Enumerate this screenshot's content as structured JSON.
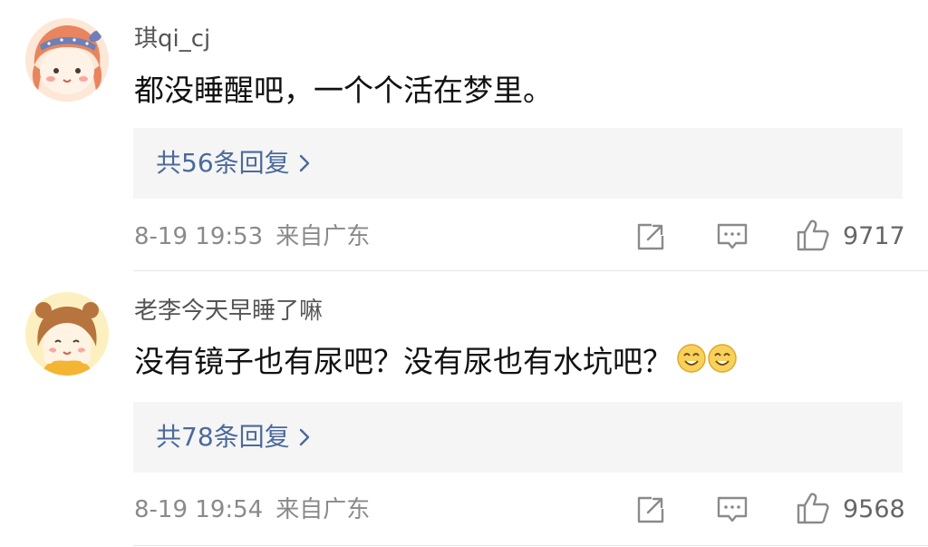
{
  "comments": [
    {
      "username": "琪qi_cj",
      "content": "都没睡醒吧，一个个活在梦里。",
      "replies_label": "共56条回复",
      "time": "8-19 19:53",
      "source": "来自广东",
      "likes": "9717",
      "avatar": "cartoon-girl-headband-avatar"
    },
    {
      "username": "老李今天早睡了嘛",
      "content": "没有镜子也有尿吧？没有尿也有水坑吧？",
      "emoji": [
        "smile-face-emoji",
        "smile-face-emoji"
      ],
      "replies_label": "共78条回复",
      "time": "8-19 19:54",
      "source": "来自广东",
      "likes": "9568",
      "avatar": "cartoon-girl-buns-avatar"
    }
  ],
  "icons": {
    "share": "share-icon",
    "comment": "comment-icon",
    "like": "thumbs-up-icon",
    "chevron": "chevron-right-icon"
  },
  "colors": {
    "link_blue": "#4b6a9b",
    "reply_box_bg": "#f5f5f5",
    "meta_gray": "#8a8a8a"
  }
}
